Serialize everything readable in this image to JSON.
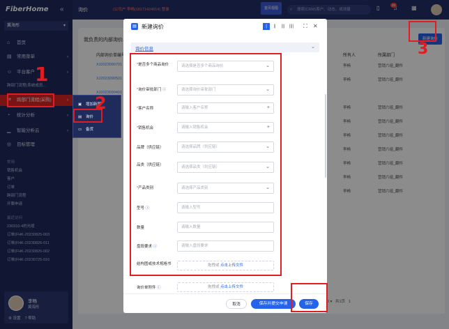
{
  "sidebar": {
    "logo": "FiberHome",
    "collapse_icon": "«",
    "org": "冀海彤",
    "items": [
      {
        "label": "首页",
        "icon": "home-icon",
        "glyph": "⌂"
      },
      {
        "label": "常用菜单",
        "icon": "menu-icon",
        "glyph": "▤"
      },
      {
        "label": "平台客户",
        "icon": "customer-icon",
        "glyph": "☺"
      },
      {
        "label": "跨部门流程(采购)",
        "icon": "process-icon",
        "glyph": "⇄"
      },
      {
        "label": "统计分析",
        "icon": "pie-chart-icon",
        "glyph": "◔"
      },
      {
        "label": "智能分析云",
        "icon": "analysis-icon",
        "glyph": "▁"
      },
      {
        "label": "目标管理",
        "icon": "target-icon",
        "glyph": "◎"
      }
    ],
    "common_title": "常用",
    "common": [
      "销售机会",
      "客户",
      "订单",
      "跨部门流程",
      "开票申请"
    ],
    "recent_title": "最近访问",
    "recent": [
      "230310-4的光缆",
      "订单(FHK-20230825-003",
      "订单(FHK-20230826-011",
      "订单(FHK-20230826-002",
      "订单(FHK-20230725-016"
    ],
    "user": {
      "name": "李畅",
      "org": "冀海彤",
      "settings": "设置",
      "help": "帮助"
    }
  },
  "submenu": [
    "增加新国",
    "询价",
    "备货"
  ],
  "topbar": {
    "title": "询价",
    "notice": "(公司户 李畅(18171424914) 登录",
    "tag": "首页视图",
    "search_placeholder": "搜索(CRM)客户、动态、或测量",
    "badge": "20"
  },
  "page": {
    "title": "我负责的内部询价单",
    "new_button": "新建询价",
    "headers": [
      "内部询价单编号",
      "所有人",
      "所属部门"
    ],
    "rows": [
      {
        "id": "XJ2023090701",
        "owner": "李畅",
        "dept": "营销六组_翻件"
      },
      {
        "id": "XJ2023090501",
        "owner": "李畅",
        "dept": "营销六组_翻件"
      },
      {
        "id": "XJ2023090401",
        "owner": "",
        "dept": ""
      },
      {
        "id": "",
        "owner": "李畅",
        "dept": "营销六组_翻件"
      },
      {
        "id": "",
        "owner": "李畅",
        "dept": "营销六组_翻件"
      },
      {
        "id": "",
        "owner": "李畅",
        "dept": "营销六组_翻件"
      },
      {
        "id": "",
        "owner": "李畅",
        "dept": "营销六组_翻件"
      },
      {
        "id": "",
        "owner": "李畅",
        "dept": "营销六组_翻件"
      },
      {
        "id": "",
        "owner": "李畅",
        "dept": "营销六组_翻件"
      },
      {
        "id": "",
        "owner": "李畅",
        "dept": "营销六组_翻件"
      }
    ],
    "pager": {
      "size": "20",
      "total_label": "共1页",
      "page": "1"
    }
  },
  "modal": {
    "title": "新建询价",
    "section": "询价信息",
    "fields": [
      {
        "label": "是否多个商品询价",
        "required": true,
        "info": false,
        "placeholder": "请选择是否多个商品询价",
        "suffix": "⌄"
      },
      {
        "label": "询价审批部门",
        "required": true,
        "info": true,
        "placeholder": "请选择询价审批部门",
        "suffix": "⌄"
      },
      {
        "label": "客户名称",
        "required": true,
        "info": false,
        "placeholder": "请输入客户名称",
        "suffix": "+"
      },
      {
        "label": "销售机会",
        "required": true,
        "info": false,
        "placeholder": "请输入销售机会",
        "suffix": "+"
      },
      {
        "label": "品牌（供应链）",
        "required": false,
        "info": false,
        "placeholder": "请选择品牌（供应链）",
        "suffix": "⌄"
      },
      {
        "label": "品类（供应链）",
        "required": false,
        "info": false,
        "placeholder": "请选择品类（供应链）",
        "suffix": "⌄"
      },
      {
        "label": "产品类别",
        "required": true,
        "info": false,
        "placeholder": "请选择产品类别",
        "suffix": "⌄"
      },
      {
        "label": "型号",
        "required": false,
        "info": true,
        "placeholder": "请输入型号",
        "suffix": ""
      },
      {
        "label": "数量",
        "required": false,
        "info": false,
        "placeholder": "请输入数量",
        "suffix": ""
      },
      {
        "label": "盘段要求",
        "required": false,
        "info": true,
        "placeholder": "请输入盘段要求",
        "suffix": ""
      }
    ],
    "upload1": {
      "label": "结构图或技术规格书",
      "prefix": "拖拽或 ",
      "link": "点击上传文件"
    },
    "upload2": {
      "label": "询价单附件",
      "prefix": "拖拽或 ",
      "link": "点击上传文件"
    },
    "cancel": "取消",
    "save_submit": "保存并提交申请",
    "save": "保存"
  },
  "annotations": {
    "one": "1",
    "two": "2",
    "three": "3",
    "color": "#e11d22"
  }
}
